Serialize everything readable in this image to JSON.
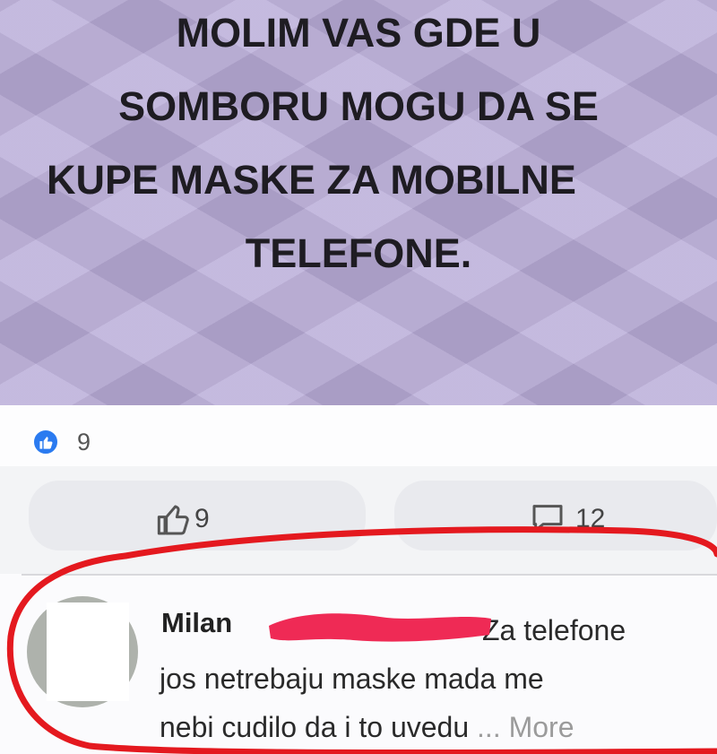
{
  "post": {
    "banner_lines": [
      "MOLIM VAS GDE U",
      "SOMBORU MOGU DA SE",
      "KUPE MASKE ZA MOBILNE",
      "TELEFONE."
    ],
    "reaction_count": "9"
  },
  "actions": {
    "like_count": "9",
    "comment_count": "12"
  },
  "comment": {
    "author": "Milan",
    "text_line1": "Za telefone",
    "text_line2": "jos netrebaju maske mada me",
    "text_line3": "nebi cudilo da i to uvedu",
    "more_label": "... More"
  },
  "colors": {
    "banner_bg": "#b9acd8",
    "like_blue": "#2b7bf0",
    "annotation_red": "#e4191f",
    "redaction_pink": "#ef2a55"
  }
}
